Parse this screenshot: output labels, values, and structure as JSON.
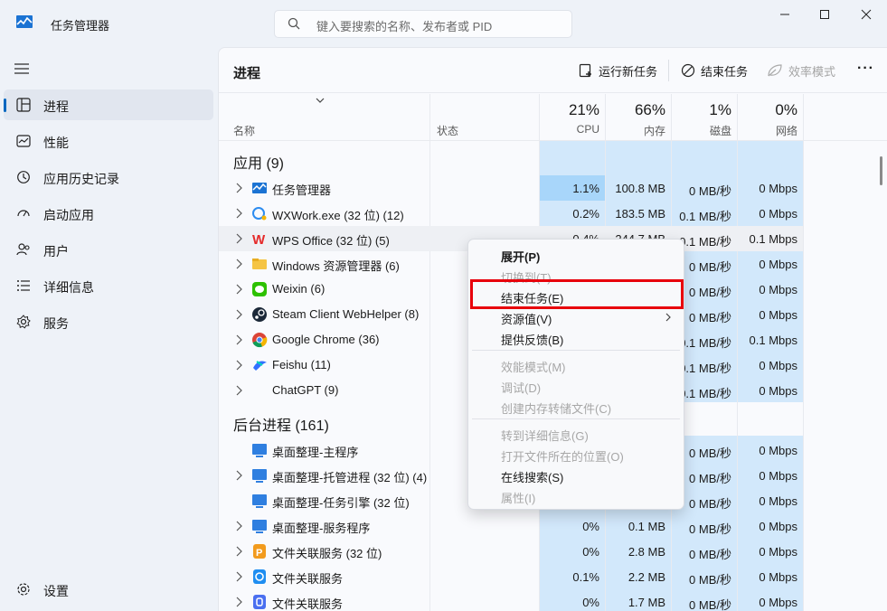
{
  "window": {
    "title": "任务管理器",
    "search_placeholder": "键入要搜索的名称、发布者或 PID"
  },
  "sidebar": {
    "items": [
      {
        "label": "进程",
        "icon": "processes-icon"
      },
      {
        "label": "性能",
        "icon": "performance-icon"
      },
      {
        "label": "应用历史记录",
        "icon": "app-history-icon"
      },
      {
        "label": "启动应用",
        "icon": "startup-icon"
      },
      {
        "label": "用户",
        "icon": "users-icon"
      },
      {
        "label": "详细信息",
        "icon": "details-icon"
      },
      {
        "label": "服务",
        "icon": "services-icon"
      }
    ],
    "settings_label": "设置"
  },
  "toolbar": {
    "page_title": "进程",
    "run_new_task": "运行新任务",
    "end_task": "结束任务",
    "efficiency_mode": "效率模式"
  },
  "table": {
    "headers": {
      "name": "名称",
      "status": "状态",
      "cpu_pct": "21%",
      "cpu_label": "CPU",
      "mem_pct": "66%",
      "mem_label": "内存",
      "disk_pct": "1%",
      "disk_label": "磁盘",
      "net_pct": "0%",
      "net_label": "网络"
    },
    "apps_group": "应用 (9)",
    "apps": [
      {
        "name": "任务管理器",
        "cpu": "1.1%",
        "mem": "100.8 MB",
        "disk": "0 MB/秒",
        "net": "0 Mbps"
      },
      {
        "name": "WXWork.exe (32 位) (12)",
        "cpu": "0.2%",
        "mem": "183.5 MB",
        "disk": "0.1 MB/秒",
        "net": "0 Mbps"
      },
      {
        "name": "WPS Office (32 位) (5)",
        "cpu": "0.4%",
        "mem": "244.7 MB",
        "disk": "0.1 MB/秒",
        "net": "0.1 Mbps"
      },
      {
        "name": "Windows 资源管理器 (6)",
        "cpu": "",
        "mem": "",
        "disk": "0 MB/秒",
        "net": "0 Mbps"
      },
      {
        "name": "Weixin (6)",
        "cpu": "",
        "mem": "",
        "disk": "0 MB/秒",
        "net": "0 Mbps"
      },
      {
        "name": "Steam Client WebHelper (8)",
        "cpu": "",
        "mem": "",
        "disk": "0 MB/秒",
        "net": "0 Mbps"
      },
      {
        "name": "Google Chrome (36)",
        "cpu": "",
        "mem": "",
        "disk": "0.1 MB/秒",
        "net": "0.1 Mbps"
      },
      {
        "name": "Feishu (11)",
        "cpu": "",
        "mem": "",
        "disk": "0.1 MB/秒",
        "net": "0 Mbps"
      },
      {
        "name": "ChatGPT (9)",
        "cpu": "",
        "mem": "",
        "disk": "0.1 MB/秒",
        "net": "0 Mbps"
      }
    ],
    "bg_group": "后台进程 (161)",
    "bg": [
      {
        "name": "桌面整理-主程序",
        "cpu": "",
        "mem": "",
        "disk": "0 MB/秒",
        "net": "0 Mbps"
      },
      {
        "name": "桌面整理-托管进程 (32 位) (4)",
        "cpu": "",
        "mem": "",
        "disk": "0 MB/秒",
        "net": "0 Mbps"
      },
      {
        "name": "桌面整理-任务引擎 (32 位)",
        "cpu": "",
        "mem": "",
        "disk": "0 MB/秒",
        "net": "0 Mbps"
      },
      {
        "name": "桌面整理-服务程序",
        "cpu": "0%",
        "mem": "0.1 MB",
        "disk": "0 MB/秒",
        "net": "0 Mbps"
      },
      {
        "name": "文件关联服务 (32 位)",
        "cpu": "0%",
        "mem": "2.8 MB",
        "disk": "0 MB/秒",
        "net": "0 Mbps"
      },
      {
        "name": "文件关联服务",
        "cpu": "0.1%",
        "mem": "2.2 MB",
        "disk": "0 MB/秒",
        "net": "0 Mbps"
      },
      {
        "name": "文件关联服务",
        "cpu": "0%",
        "mem": "1.7 MB",
        "disk": "0 MB/秒",
        "net": "0 Mbps"
      }
    ]
  },
  "context_menu": {
    "expand": "展开(P)",
    "switch_to": "切换到(T)",
    "end_task": "结束任务(E)",
    "resource_values": "资源值(V)",
    "feedback": "提供反馈(B)",
    "efficiency": "效能模式(M)",
    "debug": "调试(D)",
    "dump": "创建内存转储文件(C)",
    "go_details": "转到详细信息(G)",
    "open_location": "打开文件所在的位置(O)",
    "search_online": "在线搜索(S)",
    "properties": "属性(I)"
  },
  "colors": {
    "accent": "#0067c0",
    "heat_low": "#d2e8fb",
    "heat_high": "#a8d6fa",
    "highlight_box": "#e8000b"
  }
}
